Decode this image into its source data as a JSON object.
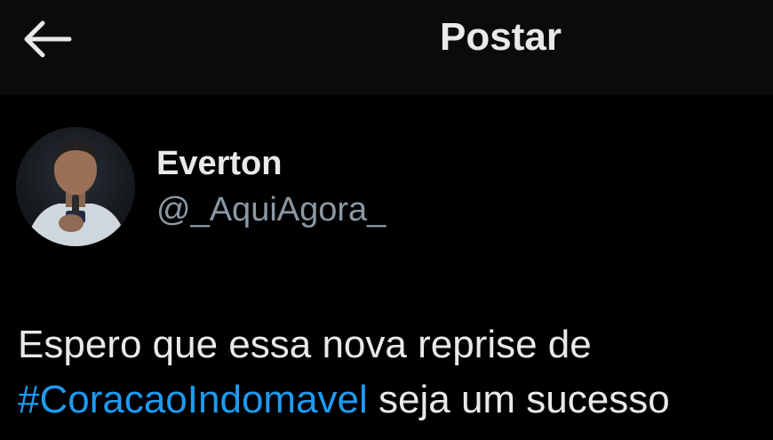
{
  "header": {
    "back_icon": "arrow-left-icon",
    "title": "Postar"
  },
  "post": {
    "author": {
      "avatar_icon": "user-avatar",
      "display_name": "Everton",
      "handle": "@_AquiAgora_"
    },
    "text": {
      "line1": "Espero que essa nova reprise de",
      "hashtag": "#CoracaoIndomavel",
      "line2_rest": " seja um sucesso"
    }
  },
  "colors": {
    "background": "#000000",
    "header_background": "#0b0b0c",
    "text": "#e7e9ea",
    "secondary_text": "#8b98a5",
    "link": "#1d9bf0"
  }
}
